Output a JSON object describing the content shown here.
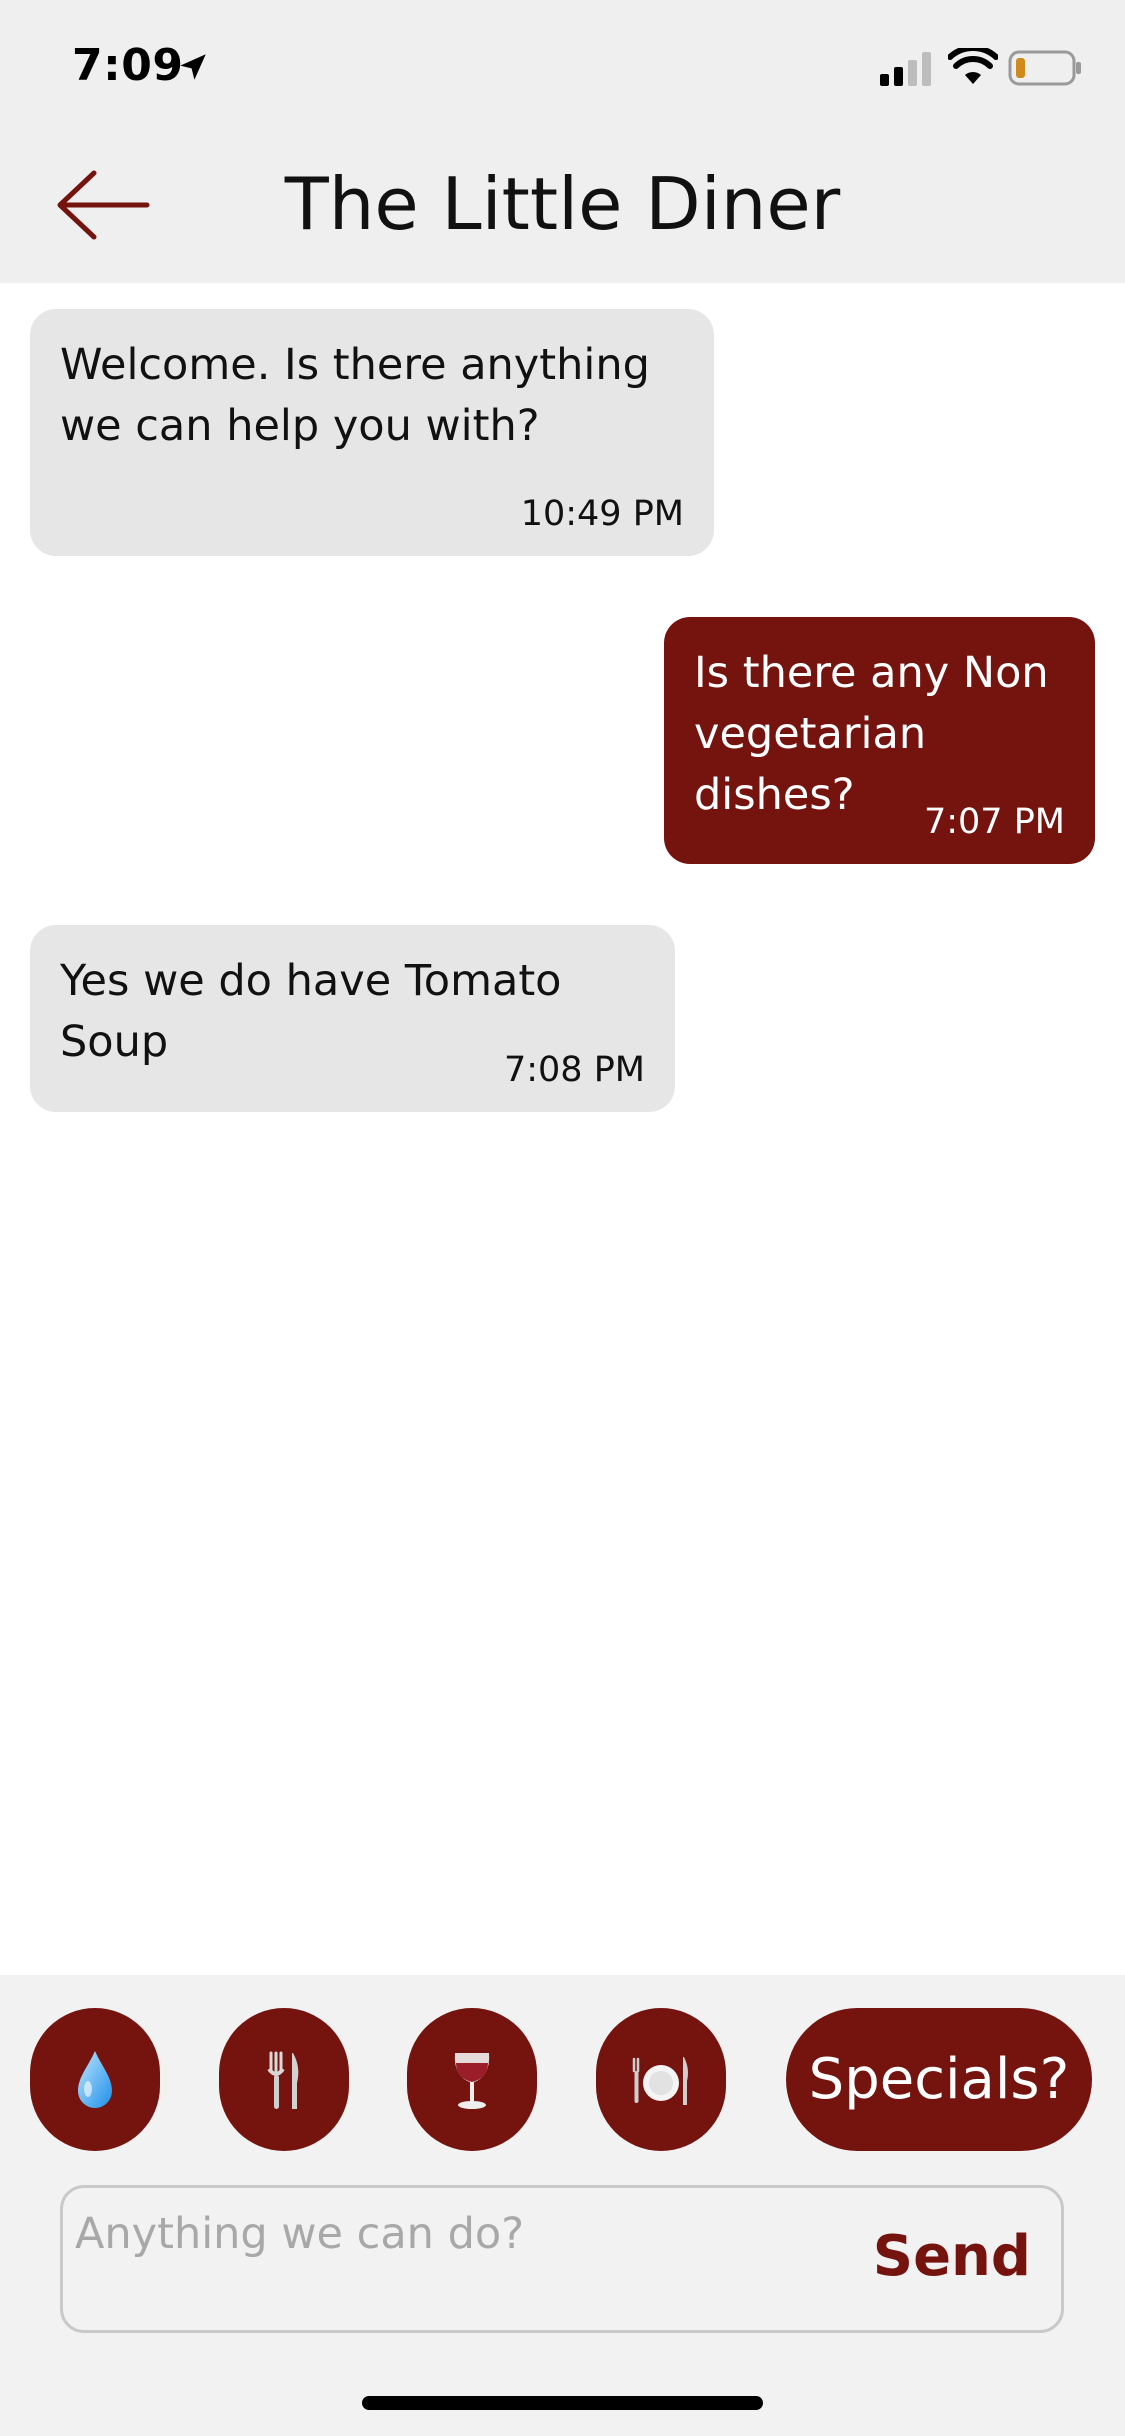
{
  "status_bar": {
    "time": "7:09",
    "icons": [
      "location-arrow-icon",
      "signal-icon",
      "wifi-icon",
      "battery-icon"
    ]
  },
  "header": {
    "back_icon": "arrow-left-icon",
    "title": "The Little Diner"
  },
  "messages": [
    {
      "direction": "incoming",
      "text": "Welcome. Is there anything we can help you with?",
      "time": "10:49 PM"
    },
    {
      "direction": "outgoing",
      "text": "Is there any Non vegetarian dishes?",
      "time": "7:07 PM"
    },
    {
      "direction": "incoming",
      "text": "Yes we do have Tomato Soup",
      "time": "7:08 PM"
    }
  ],
  "quick_actions": {
    "buttons": [
      {
        "icon": "water-drop-icon"
      },
      {
        "icon": "fork-knife-icon"
      },
      {
        "icon": "wine-glass-icon"
      },
      {
        "icon": "plate-cutlery-icon"
      }
    ],
    "specials_label": "Specials?"
  },
  "composer": {
    "placeholder": "Anything we can do?",
    "value": "",
    "send_label": "Send"
  },
  "colors": {
    "accent": "#75130f",
    "incoming_bubble": "#e6e6e6",
    "header_background": "#efefef",
    "composer_background": "#f2f2f2"
  }
}
